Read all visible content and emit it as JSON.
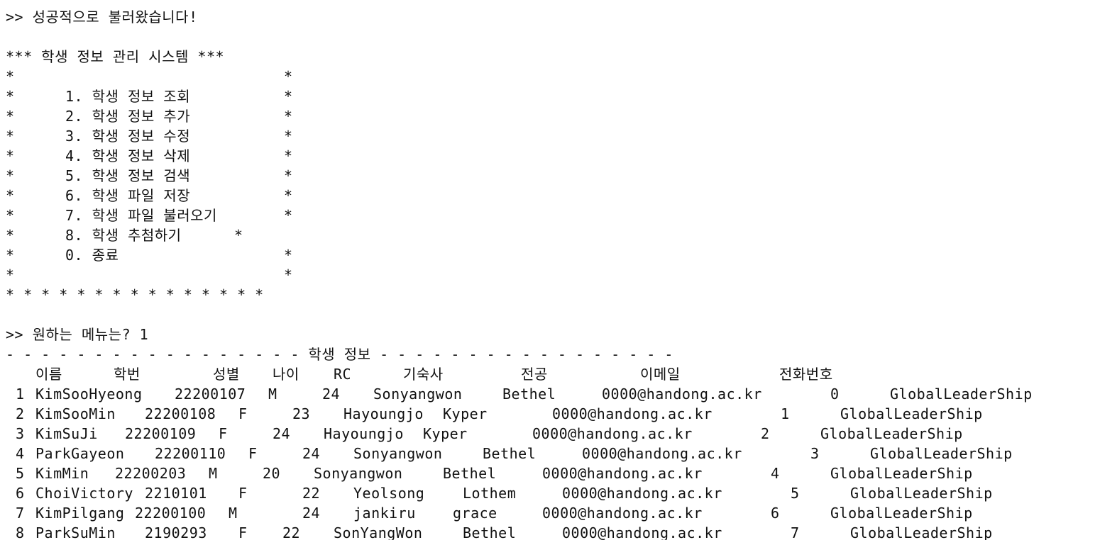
{
  "terminal": {
    "load_message": ">> 성공적으로 불러왔습니다!",
    "menu_title": "*** 학생 정보 관리 시스템 ***",
    "menu_border_left": "*",
    "menu_border_right": "*",
    "menu_items": [
      "1. 학생 정보 조회",
      "2. 학생 정보 추가",
      "3. 학생 정보 수정",
      "4. 학생 정보 삭제",
      "5. 학생 정보 검색",
      "6. 학생 파일 저장",
      "7. 학생 파일 불러오기",
      "8. 학생 추첨하기",
      "0. 종료"
    ],
    "menu_bottom": "* * * * * * * * * * * * * * *",
    "prompt": ">> 원하는 메뉴는? 1",
    "section_title": "- - - - - - - - - - - - - - - - - 학생 정보 - - - - - - - - - - - - - - - - -",
    "table": {
      "headers": [
        "이름",
        "학번",
        "성별",
        "나이",
        "RC",
        "기숙사",
        "전공",
        "이메일",
        "전화번호"
      ],
      "rows": [
        [
          "1",
          "KimSooHyeong",
          "22200107",
          "M",
          "24",
          "Sonyangwon",
          "Bethel",
          "0000@handong.ac.kr",
          "0",
          "GlobalLeaderShip"
        ],
        [
          "2",
          "KimSooMin",
          "22200108",
          "F",
          "23",
          "Hayoungjo",
          "Kyper",
          "0000@handong.ac.kr",
          "1",
          "GlobalLeaderShip"
        ],
        [
          "3",
          "KimSuJi",
          "22200109",
          "F",
          "24",
          "Hayoungjo",
          "Kyper",
          "0000@handong.ac.kr",
          "2",
          "GlobalLeaderShip"
        ],
        [
          "4",
          "ParkGayeon",
          "22200110",
          "F",
          "24",
          "Sonyangwon",
          "Bethel",
          "0000@handong.ac.kr",
          "3",
          "GlobalLeaderShip"
        ],
        [
          "5",
          "KimMin",
          "22200203",
          "M",
          "20",
          "Sonyangwon",
          "Bethel",
          "0000@handong.ac.kr",
          "4",
          "GlobalLeaderShip"
        ],
        [
          "6",
          "ChoiVictory",
          "2210101",
          "F",
          "22",
          "Yeolsong",
          "Lothem",
          "0000@handong.ac.kr",
          "5",
          "GlobalLeaderShip"
        ],
        [
          "7",
          "KimPilgang",
          "22200100",
          "M",
          "24",
          "jankiru",
          "grace",
          "0000@handong.ac.kr",
          "6",
          "GlobalLeaderShip"
        ],
        [
          "8",
          "ParkSuMin",
          "2190293",
          "F",
          "22",
          "SonYangWon",
          "Bethel",
          "0000@handong.ac.kr",
          "7",
          "GlobalLeaderShip"
        ]
      ]
    }
  }
}
